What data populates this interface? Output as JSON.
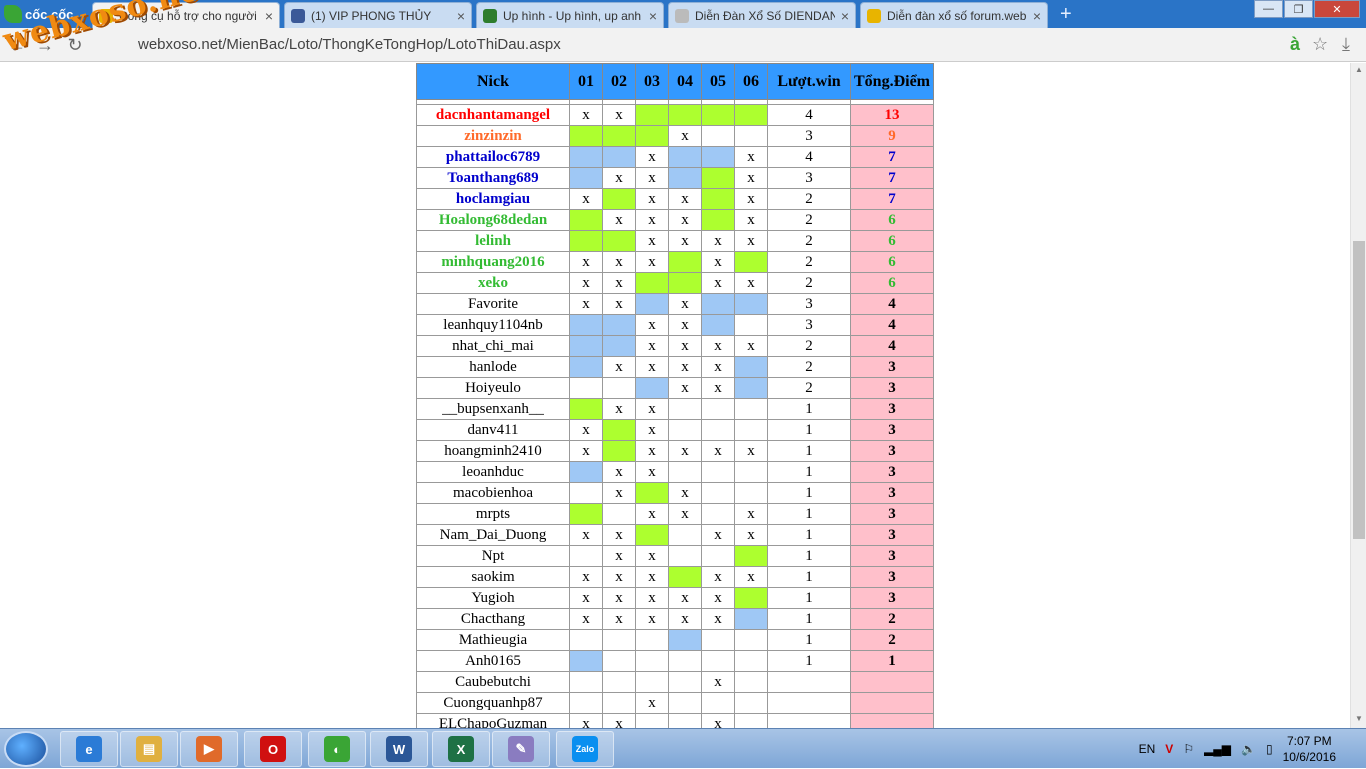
{
  "browser": {
    "brand": "cốc cốc",
    "tabs": [
      {
        "label": "Công cụ hỗ trợ cho người",
        "favicon": "xs-icon",
        "color": "#e8b400",
        "active": true
      },
      {
        "label": "(1) VIP PHONG THỦY",
        "favicon": "facebook-icon",
        "color": "#3b5998",
        "active": false
      },
      {
        "label": "Up hình - Up hình, up anh",
        "favicon": "image-icon",
        "color": "#2d7d2d",
        "active": false
      },
      {
        "label": "Diễn Đàn Xổ Số DIENDAN",
        "favicon": "page-icon",
        "color": "#bbbbbb",
        "active": false
      },
      {
        "label": "Diễn đàn xổ số forum.web",
        "favicon": "xs-icon",
        "color": "#e8b400",
        "active": false
      }
    ],
    "new_tab": "+",
    "url": "webxoso.net/MienBac/Loto/ThongKeTongHop/LotoThiDau.aspx",
    "logo_text": "webxoso.net"
  },
  "table": {
    "headers": [
      "Nick",
      "01",
      "02",
      "03",
      "04",
      "05",
      "06",
      "Lượt.win",
      "Tổng.Điểm"
    ],
    "rows": [
      {
        "nick": "dacnhantamangel",
        "color": "#ff0000",
        "cells": [
          "x",
          "x",
          "G",
          "G",
          "G",
          "G"
        ],
        "win": "4",
        "total": "13"
      },
      {
        "nick": "zinzinzin",
        "color": "#ff6a2a",
        "cells": [
          "G",
          "G",
          "G",
          "x",
          "",
          ""
        ],
        "win": "3",
        "total": "9"
      },
      {
        "nick": "phattailoc6789",
        "color": "#0000cc",
        "cells": [
          "B",
          "B",
          "x",
          "B",
          "B",
          "x"
        ],
        "win": "4",
        "total": "7"
      },
      {
        "nick": "Toanthang689",
        "color": "#0000cc",
        "cells": [
          "B",
          "x",
          "x",
          "B",
          "G",
          "x"
        ],
        "win": "3",
        "total": "7"
      },
      {
        "nick": "hoclamgiau",
        "color": "#0000cc",
        "cells": [
          "x",
          "G",
          "x",
          "x",
          "G",
          "x"
        ],
        "win": "2",
        "total": "7"
      },
      {
        "nick": "Hoalong68dedan",
        "color": "#33bb33",
        "cells": [
          "G",
          "x",
          "x",
          "x",
          "G",
          "x"
        ],
        "win": "2",
        "total": "6"
      },
      {
        "nick": "lelinh",
        "color": "#33bb33",
        "cells": [
          "G",
          "G",
          "x",
          "x",
          "x",
          "x"
        ],
        "win": "2",
        "total": "6"
      },
      {
        "nick": "minhquang2016",
        "color": "#33bb33",
        "cells": [
          "x",
          "x",
          "x",
          "G",
          "x",
          "G"
        ],
        "win": "2",
        "total": "6"
      },
      {
        "nick": "xeko",
        "color": "#33bb33",
        "cells": [
          "x",
          "x",
          "G",
          "G",
          "x",
          "x"
        ],
        "win": "2",
        "total": "6"
      },
      {
        "nick": "Favorite",
        "color": "#000000",
        "cells": [
          "x",
          "x",
          "B",
          "x",
          "B",
          "B"
        ],
        "win": "3",
        "total": "4"
      },
      {
        "nick": "leanhquy1104nb",
        "color": "#000000",
        "cells": [
          "B",
          "B",
          "x",
          "x",
          "B",
          ""
        ],
        "win": "3",
        "total": "4"
      },
      {
        "nick": "nhat_chi_mai",
        "color": "#000000",
        "cells": [
          "B",
          "B",
          "x",
          "x",
          "x",
          "x"
        ],
        "win": "2",
        "total": "4"
      },
      {
        "nick": "hanlode",
        "color": "#000000",
        "cells": [
          "B",
          "x",
          "x",
          "x",
          "x",
          "B"
        ],
        "win": "2",
        "total": "3"
      },
      {
        "nick": "Hoiyeulo",
        "color": "#000000",
        "cells": [
          "",
          "",
          "B",
          "x",
          "x",
          "B"
        ],
        "win": "2",
        "total": "3"
      },
      {
        "nick": "__bupsenxanh__",
        "color": "#000000",
        "cells": [
          "G",
          "x",
          "x",
          "",
          "",
          ""
        ],
        "win": "1",
        "total": "3"
      },
      {
        "nick": "danv411",
        "color": "#000000",
        "cells": [
          "x",
          "G",
          "x",
          "",
          "",
          ""
        ],
        "win": "1",
        "total": "3"
      },
      {
        "nick": "hoangminh2410",
        "color": "#000000",
        "cells": [
          "x",
          "G",
          "x",
          "x",
          "x",
          "x"
        ],
        "win": "1",
        "total": "3"
      },
      {
        "nick": "leoanhduc",
        "color": "#000000",
        "cells": [
          "B",
          "x",
          "x",
          "",
          "",
          ""
        ],
        "win": "1",
        "total": "3"
      },
      {
        "nick": "macobienhoa",
        "color": "#000000",
        "cells": [
          "",
          "x",
          "G",
          "x",
          "",
          ""
        ],
        "win": "1",
        "total": "3"
      },
      {
        "nick": "mrpts",
        "color": "#000000",
        "cells": [
          "G",
          "",
          "x",
          "x",
          "",
          "x"
        ],
        "win": "1",
        "total": "3"
      },
      {
        "nick": "Nam_Dai_Duong",
        "color": "#000000",
        "cells": [
          "x",
          "x",
          "G",
          "",
          "x",
          "x"
        ],
        "win": "1",
        "total": "3"
      },
      {
        "nick": "Npt",
        "color": "#000000",
        "cells": [
          "",
          "x",
          "x",
          "",
          "",
          "G"
        ],
        "win": "1",
        "total": "3"
      },
      {
        "nick": "saokim",
        "color": "#000000",
        "cells": [
          "x",
          "x",
          "x",
          "G",
          "x",
          "x"
        ],
        "win": "1",
        "total": "3"
      },
      {
        "nick": "Yugioh",
        "color": "#000000",
        "cells": [
          "x",
          "x",
          "x",
          "x",
          "x",
          "G"
        ],
        "win": "1",
        "total": "3"
      },
      {
        "nick": "Chacthang",
        "color": "#000000",
        "cells": [
          "x",
          "x",
          "x",
          "x",
          "x",
          "B"
        ],
        "win": "1",
        "total": "2"
      },
      {
        "nick": "Mathieugia",
        "color": "#000000",
        "cells": [
          "",
          "",
          "",
          "B",
          "",
          ""
        ],
        "win": "1",
        "total": "2"
      },
      {
        "nick": "Anh0165",
        "color": "#000000",
        "cells": [
          "B",
          "",
          "",
          "",
          "",
          ""
        ],
        "win": "1",
        "total": "1"
      },
      {
        "nick": "Caubebutchi",
        "color": "#000000",
        "cells": [
          "",
          "",
          "",
          "",
          "x",
          ""
        ],
        "win": "",
        "total": ""
      },
      {
        "nick": "Cuongquanhp87",
        "color": "#000000",
        "cells": [
          "",
          "",
          "x",
          "",
          "",
          ""
        ],
        "win": "",
        "total": ""
      },
      {
        "nick": "ELChapoGuzman",
        "color": "#000000",
        "cells": [
          "x",
          "x",
          "",
          "",
          "x",
          ""
        ],
        "win": "",
        "total": ""
      }
    ]
  },
  "taskbar": {
    "apps": [
      {
        "name": "ie-icon",
        "color": "#2b7bd6",
        "glyph": "e"
      },
      {
        "name": "explorer-icon",
        "color": "#e0b040",
        "glyph": "▤"
      },
      {
        "name": "media-icon",
        "color": "#e06a2a",
        "glyph": "▶"
      },
      {
        "name": "opera-icon",
        "color": "#d01010",
        "glyph": "O"
      },
      {
        "name": "coccoc-icon",
        "color": "#3aa535",
        "glyph": "◐"
      },
      {
        "name": "word-icon",
        "color": "#2b5797",
        "glyph": "W"
      },
      {
        "name": "excel-icon",
        "color": "#1e7145",
        "glyph": "X"
      },
      {
        "name": "paint-icon",
        "color": "#8a7cc0",
        "glyph": "✎"
      },
      {
        "name": "zalo-icon",
        "color": "#0a8ff0",
        "glyph": "Zalo"
      }
    ],
    "lang": "EN",
    "time": "7:07 PM",
    "date": "10/6/2016"
  }
}
